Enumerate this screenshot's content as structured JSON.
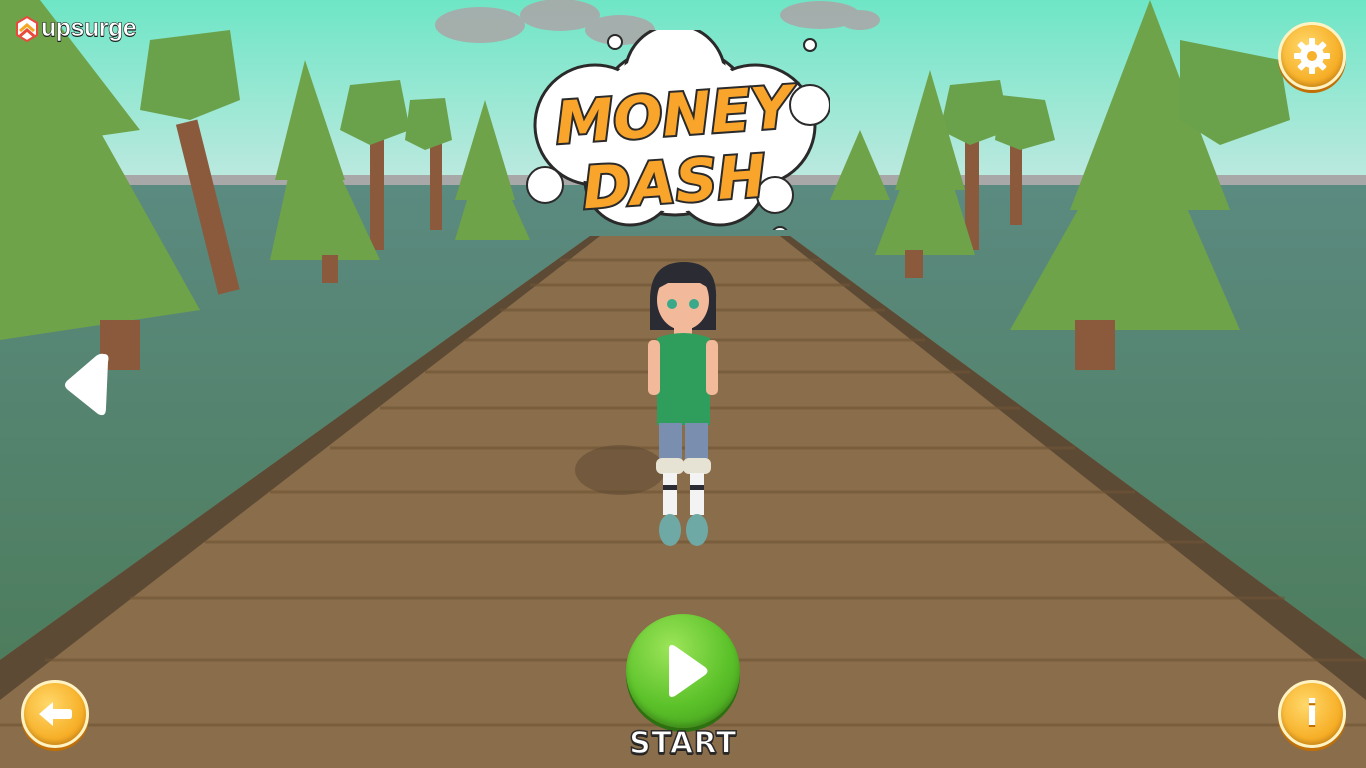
{
  "brand": {
    "name": "upsurge"
  },
  "game": {
    "title_line1": "MONEY",
    "title_line2": "DASH"
  },
  "controls": {
    "start_label": "START",
    "settings_icon": "gear-icon",
    "back_icon": "back-arrow-icon",
    "info_icon": "info-icon",
    "info_glyph": "i",
    "prev_icon": "left-arrow-icon"
  },
  "colors": {
    "sky_top": "#6fe2c0",
    "accent_orange": "#f7b12a",
    "start_green": "#5cc22a",
    "title_fill": "#f9a52b"
  }
}
